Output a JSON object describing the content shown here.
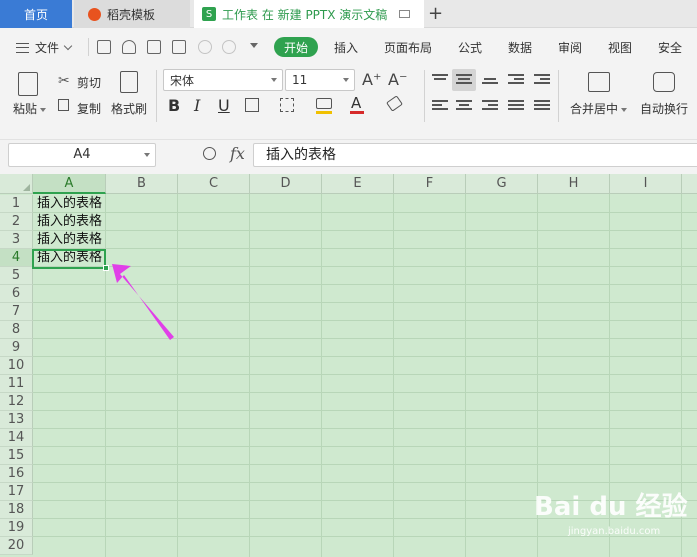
{
  "tabs": {
    "home": "首页",
    "daoke": "稻壳模板",
    "doc": "工作表 在 新建 PPTX 演示文稿",
    "doc_badge": "S"
  },
  "menu": {
    "file": "文件",
    "start": "开始",
    "items": [
      "插入",
      "页面布局",
      "公式",
      "数据",
      "审阅",
      "视图",
      "安全"
    ]
  },
  "ribbon": {
    "paste": "粘贴",
    "cut": "剪切",
    "copy": "复制",
    "format_painter": "格式刷",
    "font_name": "宋体",
    "font_size": "11",
    "bold": "B",
    "italic": "I",
    "underline": "U",
    "merge_center": "合并居中",
    "wrap_text": "自动换行"
  },
  "formula_bar": {
    "cell_ref": "A4",
    "fx": "fx",
    "content": "插入的表格"
  },
  "sheet": {
    "columns": [
      "A",
      "B",
      "C",
      "D",
      "E",
      "F",
      "G",
      "H",
      "I"
    ],
    "rows": [
      "1",
      "2",
      "3",
      "4",
      "5",
      "6",
      "7",
      "8",
      "9",
      "10",
      "11",
      "12",
      "13",
      "14",
      "15",
      "16",
      "17",
      "18",
      "19",
      "20"
    ],
    "cells": [
      "插入的表格",
      "插入的表格",
      "插入的表格",
      "插入的表格"
    ],
    "active_cell": "A4",
    "annotation_color": "#e040e8"
  },
  "watermark": {
    "brand": "Bai du 经验",
    "url": "jingyan.baidu.com"
  }
}
